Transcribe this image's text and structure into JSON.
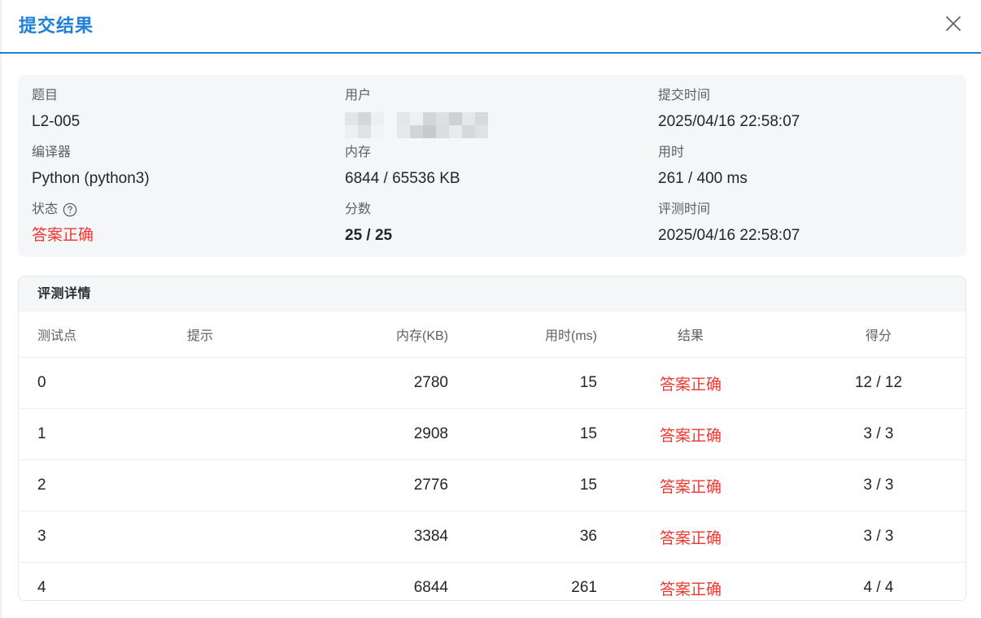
{
  "dialog": {
    "title": "提交结果"
  },
  "info": {
    "problem_label": "题目",
    "problem_value": "L2-005",
    "user_label": "用户",
    "submit_time_label": "提交时间",
    "submit_time_value": "2025/04/16 22:58:07",
    "compiler_label": "编译器",
    "compiler_value": "Python (python3)",
    "memory_label": "内存",
    "memory_value": "6844 / 65536 KB",
    "time_label": "用时",
    "time_value": "261 / 400 ms",
    "status_label": "状态",
    "status_value": "答案正确",
    "score_label": "分数",
    "score_value": "25 / 25",
    "judge_time_label": "评测时间",
    "judge_time_value": "2025/04/16 22:58:07"
  },
  "details": {
    "title": "评测详情",
    "columns": {
      "case": "测试点",
      "hint": "提示",
      "memory": "内存(KB)",
      "time": "用时(ms)",
      "result": "结果",
      "score": "得分"
    },
    "rows": [
      {
        "case": "0",
        "hint": "",
        "memory": "2780",
        "time": "15",
        "result": "答案正确",
        "score": "12 / 12"
      },
      {
        "case": "1",
        "hint": "",
        "memory": "2908",
        "time": "15",
        "result": "答案正确",
        "score": "3 / 3"
      },
      {
        "case": "2",
        "hint": "",
        "memory": "2776",
        "time": "15",
        "result": "答案正确",
        "score": "3 / 3"
      },
      {
        "case": "3",
        "hint": "",
        "memory": "3384",
        "time": "36",
        "result": "答案正确",
        "score": "3 / 3"
      },
      {
        "case": "4",
        "hint": "",
        "memory": "6844",
        "time": "261",
        "result": "答案正确",
        "score": "4 / 4"
      }
    ]
  },
  "colors": {
    "accent": "#1d7fd8",
    "success_red": "#f2362f"
  },
  "icons": {
    "close": "close-icon",
    "help": "question-circle-icon"
  }
}
